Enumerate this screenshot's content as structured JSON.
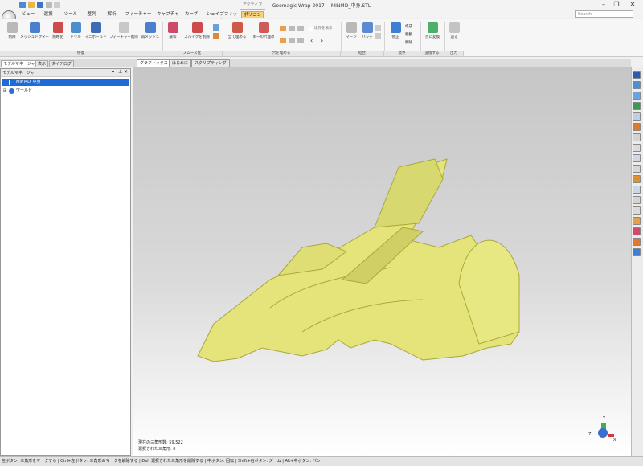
{
  "window": {
    "title": "Geomagic Wrap 2017 -- MINI4D_中身.STL",
    "context_label": "アクティブ",
    "search_placeholder": "Search",
    "min": "–",
    "max": "❐",
    "close": "✕"
  },
  "tabs": [
    {
      "label": "ビュー"
    },
    {
      "label": "選択"
    },
    {
      "label": "ツール"
    },
    {
      "label": "整列"
    },
    {
      "label": "解析"
    },
    {
      "label": "フィーチャー"
    },
    {
      "label": "キャプチャ"
    },
    {
      "label": "カーブ"
    },
    {
      "label": "シェイプフィット"
    },
    {
      "label": "ポリゴン"
    }
  ],
  "active_tab": "ポリゴン",
  "ribbon": {
    "buttons": [
      {
        "label": "削除"
      },
      {
        "label": "メッシュドクター"
      },
      {
        "label": "簡略化"
      },
      {
        "label": "ドリル"
      },
      {
        "label": "マニホールド"
      },
      {
        "label": "フィーチャー削除"
      },
      {
        "label": "再メッシュ"
      },
      {
        "label": "緩和"
      },
      {
        "label": "スパイクを削除"
      },
      {
        "label": "全て埋める"
      },
      {
        "label": "単一の穴埋め"
      },
      {
        "label": "マージ"
      },
      {
        "label": "パッチ"
      },
      {
        "label": "修正"
      },
      {
        "label": "点に変換"
      },
      {
        "label": "送る"
      }
    ],
    "small_buttons": [
      "境界を表示",
      "作成",
      "移動",
      "削除"
    ],
    "groups": [
      {
        "label": "修復"
      },
      {
        "label": "スムーズ化"
      },
      {
        "label": "穴を埋める"
      },
      {
        "label": "結合"
      },
      {
        "label": "境界"
      },
      {
        "label": "変換する"
      },
      {
        "label": "出力"
      }
    ]
  },
  "left_panel": {
    "tabs": [
      "モデルマネージャ",
      "表示",
      "ダイアログ"
    ],
    "header": "モデルマネージャ",
    "tree": [
      {
        "label": "MINI4D_中身",
        "selected": true
      },
      {
        "label": "ワールド",
        "selected": false
      }
    ]
  },
  "graphics_tabs": [
    "グラフィックス",
    "はじめに",
    "スクリプティング"
  ],
  "viewport": {
    "stats_triangles": "現在の三角形数: 59,522",
    "stats_selected": "選択された三角形: 0",
    "model_color": "#e6e67a",
    "axis_labels": {
      "x": "X",
      "y": "Y",
      "z": "Z"
    }
  },
  "status_bar": "左ボタン: 三角形をマークする | Ctrl+左ボタン: 三角形のマークを解除する | Del: 選択された三角形を削除する | 中ボタン: 回転 | Shift+右ボタン: ズーム | Alt+中ボタン: パン"
}
